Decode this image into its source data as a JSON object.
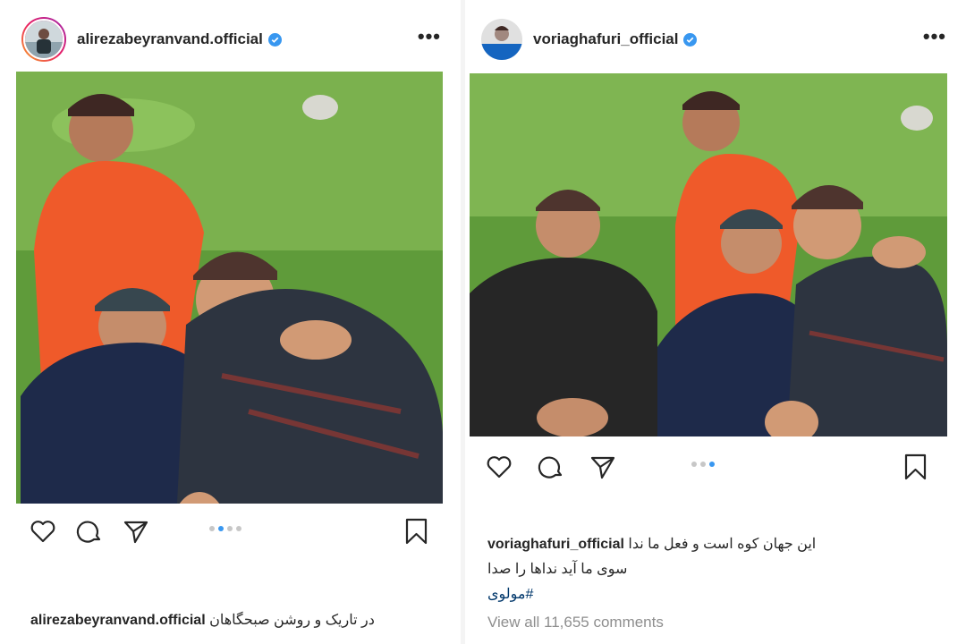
{
  "left_post": {
    "username": "alirezabeyranvand.official",
    "more_label": "•••",
    "carousel": {
      "count": 4,
      "active_index": 1
    },
    "caption": {
      "username": "alirezabeyranvand.official",
      "line1": "در تاریک و روشن صبحگاهان"
    }
  },
  "right_post": {
    "username": "voriaghafuri_official",
    "more_label": "•••",
    "carousel": {
      "count": 3,
      "active_index": 2
    },
    "caption": {
      "username": "voriaghafuri_official",
      "line1": "این جهان کوه است و فعل ما ندا",
      "line2": "سوی ما آید نداها را صدا",
      "hashtag": "#مولوی"
    },
    "view_all_comments": "View all 11,655 comments"
  },
  "colors": {
    "verified_badge": "#3897f0",
    "carousel_active": "#3897f0",
    "hashtag": "#00376b",
    "muted_text": "#8e8e8e"
  },
  "icons": [
    "verified-icon",
    "more-icon",
    "heart-icon",
    "comment-icon",
    "share-icon",
    "bookmark-icon"
  ]
}
